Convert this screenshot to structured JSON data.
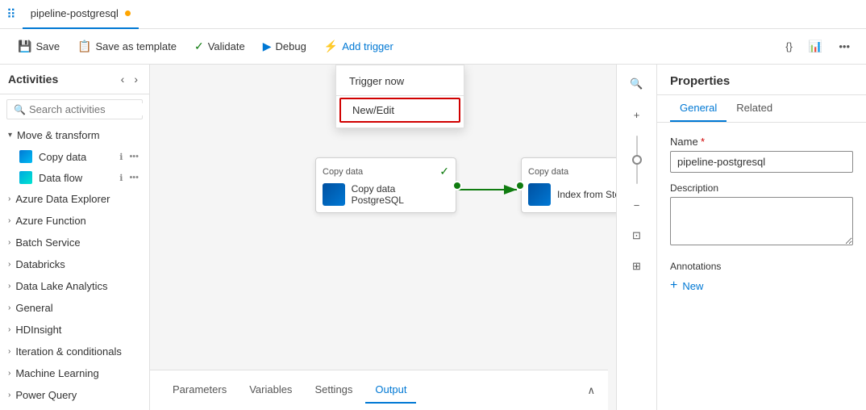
{
  "topbar": {
    "tab_label": "pipeline-postgresql",
    "tab_dot_color": "#ffa500"
  },
  "toolbar": {
    "save_label": "Save",
    "save_template_label": "Save as template",
    "validate_label": "Validate",
    "debug_label": "Debug",
    "add_trigger_label": "Add trigger"
  },
  "dropdown": {
    "trigger_now_label": "Trigger now",
    "new_edit_label": "New/Edit"
  },
  "sidebar": {
    "title": "Activities",
    "search_placeholder": "Search activities",
    "categories": [
      {
        "label": "Move & transform",
        "expanded": true
      },
      {
        "label": "Azure Data Explorer",
        "expanded": false
      },
      {
        "label": "Azure Function",
        "expanded": false
      },
      {
        "label": "Batch Service",
        "expanded": false
      },
      {
        "label": "Databricks",
        "expanded": false
      },
      {
        "label": "Data Lake Analytics",
        "expanded": false
      },
      {
        "label": "General",
        "expanded": false
      },
      {
        "label": "HDInsight",
        "expanded": false
      },
      {
        "label": "Iteration & conditionals",
        "expanded": false
      },
      {
        "label": "Machine Learning",
        "expanded": false
      },
      {
        "label": "Power Query",
        "expanded": false
      }
    ],
    "items": [
      {
        "label": "Copy data",
        "type": "copy"
      },
      {
        "label": "Data flow",
        "type": "dataflow"
      }
    ]
  },
  "pipeline": {
    "node1": {
      "type": "Copy data",
      "label": "Copy data PostgreSQL"
    },
    "node2": {
      "type": "Copy data",
      "label": "Index from Storage"
    }
  },
  "bottom_tabs": {
    "tabs": [
      "Parameters",
      "Variables",
      "Settings",
      "Output"
    ],
    "active": "Output"
  },
  "properties": {
    "title": "Properties",
    "tabs": [
      "General",
      "Related"
    ],
    "active_tab": "General",
    "name_label": "Name",
    "name_value": "pipeline-postgresql",
    "description_label": "Description",
    "description_value": "",
    "annotations_label": "Annotations",
    "new_label": "New"
  },
  "canvas_tools": {
    "search_icon": "🔍",
    "plus_icon": "+",
    "minus_icon": "−",
    "fit_icon": "⊡",
    "layout_icon": "⊞"
  }
}
